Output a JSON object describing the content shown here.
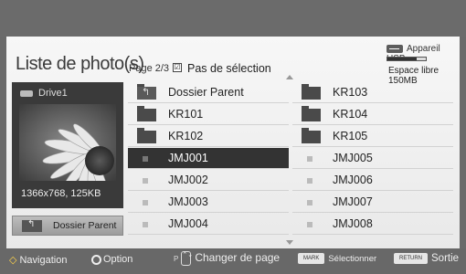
{
  "header": {
    "title": "Liste de photo(s)",
    "page_info": "Page 2/3",
    "checkbox_mark": "☑",
    "no_selection_label": "Pas de sélection"
  },
  "storage": {
    "device_label": "Appareil USB",
    "free_space": "Espace libre 150MB",
    "usage_fraction": 0.75
  },
  "preview": {
    "drive_label": "Drive1",
    "resolution_size": "1366x768, 125KB",
    "parent_button_label": "Dossier Parent"
  },
  "files": {
    "column1": [
      {
        "label": "Dossier Parent",
        "type": "parent"
      },
      {
        "label": "KR101",
        "type": "folder"
      },
      {
        "label": "KR102",
        "type": "folder"
      },
      {
        "label": "JMJ001",
        "type": "image",
        "selected": true
      },
      {
        "label": "JMJ002",
        "type": "image"
      },
      {
        "label": "JMJ003",
        "type": "image"
      },
      {
        "label": "JMJ004",
        "type": "image"
      }
    ],
    "column2": [
      {
        "label": "KR103",
        "type": "folder"
      },
      {
        "label": "KR104",
        "type": "folder"
      },
      {
        "label": "KR105",
        "type": "folder"
      },
      {
        "label": "JMJ005",
        "type": "image"
      },
      {
        "label": "JMJ006",
        "type": "image"
      },
      {
        "label": "JMJ007",
        "type": "image"
      },
      {
        "label": "JMJ008",
        "type": "image"
      }
    ]
  },
  "footer": {
    "navigation_icon": "◇",
    "navigation_label": "Navigation",
    "option_label": "Option",
    "p_key": "P",
    "updown_glyph": "⌃⌄",
    "page_change_label": "Changer de page",
    "mark_key": "MARK",
    "select_label": "Sélectionner",
    "return_key": "RETURN",
    "exit_label": "Sortie"
  }
}
